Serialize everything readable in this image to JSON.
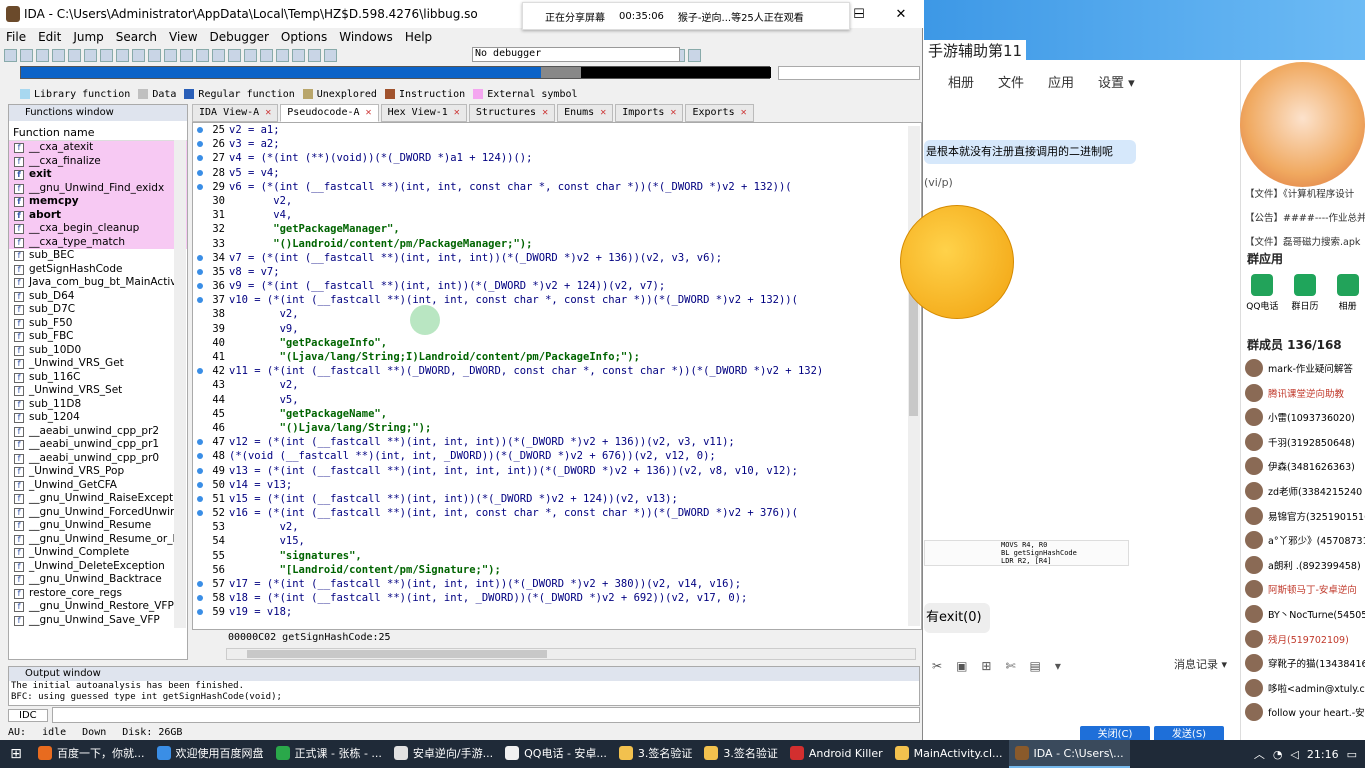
{
  "ida": {
    "title": "IDA - C:\\Users\\Administrator\\AppData\\Local\\Temp\\HZ$D.598.4276\\libbug.so",
    "menu": [
      "File",
      "Edit",
      "Jump",
      "Search",
      "View",
      "Debugger",
      "Options",
      "Windows",
      "Help"
    ],
    "debugger_select": "No debugger",
    "legend": [
      {
        "label": "Library function",
        "color": "#a8d8f0"
      },
      {
        "label": "Data",
        "color": "#c0c0c0"
      },
      {
        "label": "Regular function",
        "color": "#2a5fb8"
      },
      {
        "label": "Unexplored",
        "color": "#b9a66b"
      },
      {
        "label": "Instruction",
        "color": "#a0522d"
      },
      {
        "label": "External symbol",
        "color": "#f4a6f0"
      }
    ],
    "functions_window": {
      "title": "Functions window",
      "column": "Function name",
      "items": [
        {
          "name": "__cxa_atexit",
          "kind": "lib"
        },
        {
          "name": "__cxa_finalize",
          "kind": "lib"
        },
        {
          "name": "exit",
          "kind": "libbold"
        },
        {
          "name": "__gnu_Unwind_Find_exidx",
          "kind": "lib"
        },
        {
          "name": "memcpy",
          "kind": "libbold"
        },
        {
          "name": "abort",
          "kind": "libbold"
        },
        {
          "name": "__cxa_begin_cleanup",
          "kind": "lib"
        },
        {
          "name": "__cxa_type_match",
          "kind": "lib"
        },
        {
          "name": "sub_BEC",
          "kind": "reg"
        },
        {
          "name": "getSignHashCode",
          "kind": "reg"
        },
        {
          "name": "Java_com_bug_bt_MainActivi",
          "kind": "reg"
        },
        {
          "name": "sub_D64",
          "kind": "reg"
        },
        {
          "name": "sub_D7C",
          "kind": "reg"
        },
        {
          "name": "sub_F50",
          "kind": "reg"
        },
        {
          "name": "sub_FBC",
          "kind": "reg"
        },
        {
          "name": "sub_10D0",
          "kind": "reg"
        },
        {
          "name": "_Unwind_VRS_Get",
          "kind": "reg"
        },
        {
          "name": "sub_116C",
          "kind": "reg"
        },
        {
          "name": "_Unwind_VRS_Set",
          "kind": "reg"
        },
        {
          "name": "sub_11D8",
          "kind": "reg"
        },
        {
          "name": "sub_1204",
          "kind": "reg"
        },
        {
          "name": "__aeabi_unwind_cpp_pr2",
          "kind": "reg"
        },
        {
          "name": "__aeabi_unwind_cpp_pr1",
          "kind": "reg"
        },
        {
          "name": "__aeabi_unwind_cpp_pr0",
          "kind": "reg"
        },
        {
          "name": "_Unwind_VRS_Pop",
          "kind": "reg"
        },
        {
          "name": "_Unwind_GetCFA",
          "kind": "reg"
        },
        {
          "name": "__gnu_Unwind_RaiseExceptio",
          "kind": "reg"
        },
        {
          "name": "__gnu_Unwind_ForcedUnwir",
          "kind": "reg"
        },
        {
          "name": "__gnu_Unwind_Resume",
          "kind": "reg"
        },
        {
          "name": "__gnu_Unwind_Resume_or_F",
          "kind": "reg"
        },
        {
          "name": "_Unwind_Complete",
          "kind": "reg"
        },
        {
          "name": "_Unwind_DeleteException",
          "kind": "reg"
        },
        {
          "name": "__gnu_Unwind_Backtrace",
          "kind": "reg"
        },
        {
          "name": "restore_core_regs",
          "kind": "reg"
        },
        {
          "name": "__gnu_Unwind_Restore_VFP",
          "kind": "reg"
        },
        {
          "name": "__gnu_Unwind_Save_VFP",
          "kind": "reg"
        }
      ]
    },
    "tabs": [
      {
        "label": "IDA View-A",
        "active": false
      },
      {
        "label": "Pseudocode-A",
        "active": true
      },
      {
        "label": "Hex View-1",
        "active": false
      },
      {
        "label": "Structures",
        "active": false
      },
      {
        "label": "Enums",
        "active": false
      },
      {
        "label": "Imports",
        "active": false
      },
      {
        "label": "Exports",
        "active": false
      }
    ],
    "code_lines": [
      {
        "n": "25",
        "dot": true,
        "t": "v2 = a1;"
      },
      {
        "n": "26",
        "dot": true,
        "t": "v3 = a2;"
      },
      {
        "n": "27",
        "dot": true,
        "t": "v4 = (*(int (**)(void))(*(_DWORD *)a1 + 124))();"
      },
      {
        "n": "28",
        "dot": true,
        "t": "v5 = v4;"
      },
      {
        "n": "29",
        "dot": true,
        "t": "v6 = (*(int (__fastcall **)(int, int, const char *, const char *))(*(_DWORD *)v2 + 132))("
      },
      {
        "n": "30",
        "dot": false,
        "t": "       v2,"
      },
      {
        "n": "31",
        "dot": false,
        "t": "       v4,"
      },
      {
        "n": "32",
        "dot": false,
        "t": "       \"getPackageManager\",",
        "s": true
      },
      {
        "n": "33",
        "dot": false,
        "t": "       \"()Landroid/content/pm/PackageManager;\");",
        "s": true
      },
      {
        "n": "34",
        "dot": true,
        "t": "v7 = (*(int (__fastcall **)(int, int, int))(*(_DWORD *)v2 + 136))(v2, v3, v6);"
      },
      {
        "n": "35",
        "dot": true,
        "t": "v8 = v7;"
      },
      {
        "n": "36",
        "dot": true,
        "t": "v9 = (*(int (__fastcall **)(int, int))(*(_DWORD *)v2 + 124))(v2, v7);"
      },
      {
        "n": "37",
        "dot": true,
        "t": "v10 = (*(int (__fastcall **)(int, int, const char *, const char *))(*(_DWORD *)v2 + 132))("
      },
      {
        "n": "38",
        "dot": false,
        "t": "        v2,"
      },
      {
        "n": "39",
        "dot": false,
        "t": "        v9,"
      },
      {
        "n": "40",
        "dot": false,
        "t": "        \"getPackageInfo\",",
        "s": true
      },
      {
        "n": "41",
        "dot": false,
        "t": "        \"(Ljava/lang/String;I)Landroid/content/pm/PackageInfo;\");",
        "s": true
      },
      {
        "n": "42",
        "dot": true,
        "t": "v11 = (*(int (__fastcall **)(_DWORD, _DWORD, const char *, const char *))(*(_DWORD *)v2 + 132)"
      },
      {
        "n": "43",
        "dot": false,
        "t": "        v2,"
      },
      {
        "n": "44",
        "dot": false,
        "t": "        v5,"
      },
      {
        "n": "45",
        "dot": false,
        "t": "        \"getPackageName\",",
        "s": true
      },
      {
        "n": "46",
        "dot": false,
        "t": "        \"()Ljava/lang/String;\");",
        "s": true
      },
      {
        "n": "47",
        "dot": true,
        "t": "v12 = (*(int (__fastcall **)(int, int, int))(*(_DWORD *)v2 + 136))(v2, v3, v11);"
      },
      {
        "n": "48",
        "dot": true,
        "t": "(*(void (__fastcall **)(int, int, _DWORD))(*(_DWORD *)v2 + 676))(v2, v12, 0);"
      },
      {
        "n": "49",
        "dot": true,
        "t": "v13 = (*(int (__fastcall **)(int, int, int, int))(*(_DWORD *)v2 + 136))(v2, v8, v10, v12);"
      },
      {
        "n": "50",
        "dot": true,
        "t": "v14 = v13;"
      },
      {
        "n": "51",
        "dot": true,
        "t": "v15 = (*(int (__fastcall **)(int, int))(*(_DWORD *)v2 + 124))(v2, v13);"
      },
      {
        "n": "52",
        "dot": true,
        "t": "v16 = (*(int (__fastcall **)(int, int, const char *, const char *))(*(_DWORD *)v2 + 376))("
      },
      {
        "n": "53",
        "dot": false,
        "t": "        v2,"
      },
      {
        "n": "54",
        "dot": false,
        "t": "        v15,"
      },
      {
        "n": "55",
        "dot": false,
        "t": "        \"signatures\",",
        "s": true
      },
      {
        "n": "56",
        "dot": false,
        "t": "        \"[Landroid/content/pm/Signature;\");",
        "s": true
      },
      {
        "n": "57",
        "dot": true,
        "t": "v17 = (*(int (__fastcall **)(int, int, int))(*(_DWORD *)v2 + 380))(v2, v14, v16);"
      },
      {
        "n": "58",
        "dot": true,
        "t": "v18 = (*(int (__fastcall **)(int, int, _DWORD))(*(_DWORD *)v2 + 692))(v2, v17, 0);"
      },
      {
        "n": "59",
        "dot": true,
        "t": "v19 = v18;"
      }
    ],
    "code_status": "00000C02 getSignHashCode:25",
    "output": {
      "title": "Output window",
      "lines": [
        "The initial autoanalysis has been finished.",
        "BFC: using guessed type int getSignHashCode(void);"
      ]
    },
    "idc_label": "IDC",
    "status": {
      "au": "AU:",
      "state": "idle",
      "dir": "Down",
      "disk": "Disk: 26GB"
    }
  },
  "share": {
    "status": "正在分享屏幕",
    "time": "00:35:06",
    "viewers": "猴子-逆向...等25人正在观看"
  },
  "qq": {
    "group_title": "手游辅助第11",
    "nav": [
      "相册",
      "文件",
      "应用",
      "设置 ▾"
    ],
    "bubble": "是根本就没有注册直接调用的二进制呢",
    "sub": "(vi/p)",
    "exit_msg": "有exit(0)",
    "msg_record": "消息记录 ▾",
    "close_btn": "关闭(C)",
    "send_btn": "发送(S)",
    "notices": [
      "【文件】《计算机程序设计",
      "【公告】####----作业总并",
      "【文件】磊哥磁力搜索.apk"
    ],
    "group_apps_title": "群应用",
    "apps": [
      {
        "label": "QQ电话",
        "color": "#22a35a"
      },
      {
        "label": "群日历",
        "color": "#1fa55b"
      },
      {
        "label": "相册",
        "color": "#22a35a"
      }
    ],
    "members_title": "群成员 136/168",
    "members": [
      "mark-作业疑问解答",
      "腾讯课堂逆向助教",
      "小雷(1093736020)",
      "千羽(3192850648)",
      "伊森(3481626363)",
      "zd老师(3384215240",
      "易锦官方(3251901516",
      "a°丫邪少》(45708731",
      "a朗利 .(892399458)",
      "阿斯顿马丁-安卓逆向",
      "BY丶NocTurne(545054",
      "残月(519702109)",
      "穿靴子的猫(13438416",
      "哆啦<admin@xtuly.cn",
      "follow your heart.-安卓"
    ],
    "snip_lines": [
      "MOVS    R4, R0",
      "BL      getSignHashCode",
      "LDR     R2, [R4]"
    ]
  },
  "taskbar": {
    "tasks": [
      {
        "label": "百度一下，你就...",
        "color": "#e86b1f"
      },
      {
        "label": "欢迎使用百度网盘",
        "color": "#3a8ee6"
      },
      {
        "label": "正式课 - 张栋 - ...",
        "color": "#2aa84a"
      },
      {
        "label": "安卓逆向/手游...",
        "color": "#e1e1e1"
      },
      {
        "label": "QQ电话 - 安卓...",
        "color": "#f0f0f0"
      },
      {
        "label": "3.签名验证",
        "color": "#f2c14e"
      },
      {
        "label": "3.签名验证",
        "color": "#f2c14e"
      },
      {
        "label": "Android Killer",
        "color": "#d32f2f"
      },
      {
        "label": "MainActivity.cl...",
        "color": "#f2c14e"
      },
      {
        "label": "IDA - C:\\Users\\...",
        "color": "#8a5a2b"
      }
    ],
    "time": "21:16"
  }
}
